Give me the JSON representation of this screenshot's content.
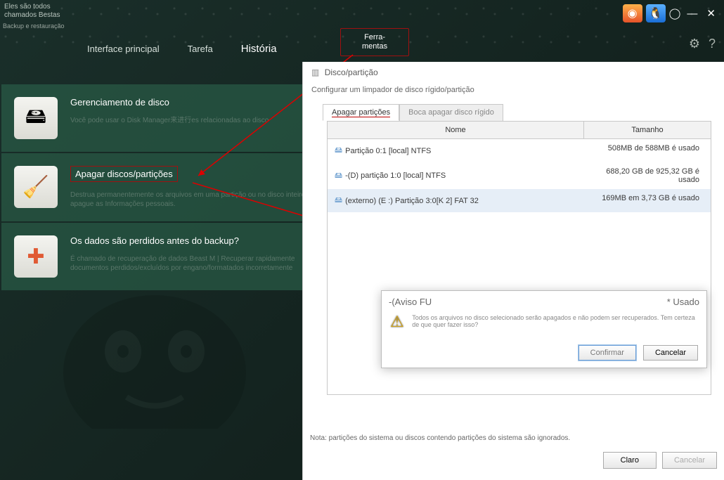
{
  "topbar": {
    "line1": "Eles são todos",
    "line2": "chamados Bestas",
    "sub": "Backup e restauração"
  },
  "nav": {
    "item1": "Interface principal",
    "item2": "Tarefa",
    "item3": "História",
    "tools_line1": "Ferra-",
    "tools_line2": "mentas"
  },
  "features": [
    {
      "title": "Gerenciamento de disco",
      "desc": "Você pode usar o Disk Manager来进行es relacionadas ao disco"
    },
    {
      "title": "Apagar discos/partições",
      "desc": "Destrua permanentemente os arquivos em uma partição ou no disco inteiro e apague as Informações pessoais."
    },
    {
      "title": "Os dados são perdidos antes do backup?",
      "desc": "É chamado de recuperação de dados Beast M | Recuperar rapidamente documentos perdidos/excluídos por engano/formatados incorretamente"
    }
  ],
  "panel": {
    "title": "Disco/partição",
    "sub": "Configurar um limpador de disco rígido/partição",
    "tab_active": "Apagar partições",
    "tab_inactive": "Boca apagar disco rígido",
    "columns": {
      "name": "Nome",
      "size": "Tamanho"
    },
    "rows": [
      {
        "name": "Partição 0:1 [local] NTFS",
        "size": "508MB de 588MB é usado"
      },
      {
        "name": "-(D) partição 1:0 [local] NTFS",
        "size": "688,20 GB de 925,32 GB é usado"
      },
      {
        "name": "(externo) (E :) Partição 3:0[K 2] FAT 32",
        "size": "169MB em 3,73 GB é usado"
      }
    ],
    "note": "Nota: partições do sistema ou discos contendo partições do sistema são ignorados.",
    "btn_ok": "Claro",
    "btn_cancel": "Cancelar"
  },
  "modal": {
    "title": "-(Aviso FU",
    "used": "* Usado",
    "msg": "Todos os arquivos no disco selecionado serão apagados e não podem ser recuperados. Tem certeza de que quer fazer isso?",
    "confirm": "Confirmar",
    "cancel": "Cancelar"
  }
}
